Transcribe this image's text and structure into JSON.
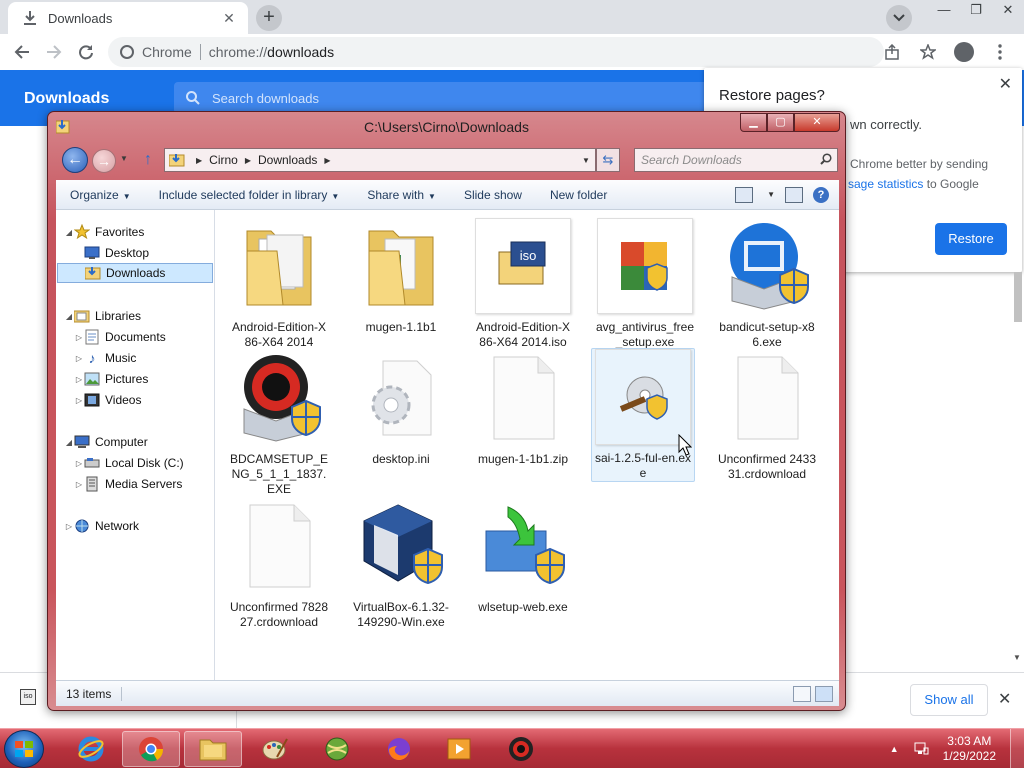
{
  "chrome": {
    "tab_title": "Downloads",
    "tab_close": "✕",
    "new_tab": "+",
    "window_min": "—",
    "window_max": "❐",
    "window_close": "✕",
    "site_name": "Chrome",
    "url_scheme": "chrome://",
    "url_host": "downloads",
    "page_title": "Downloads",
    "search_placeholder": "Search downloads",
    "icons": [
      "download-icon",
      "back-arrow-icon",
      "forward-arrow-icon",
      "reload-icon",
      "share-icon",
      "star-icon",
      "profile-icon",
      "kebab-menu-icon"
    ]
  },
  "restore_dialog": {
    "title": "Restore pages?",
    "line1": "wn correctly.",
    "line2": "Chrome better by sending",
    "line3_link": "sage statistics",
    "line3_rest": " to Google",
    "button": "Restore",
    "close": "✕"
  },
  "download_shelf": {
    "show_all": "Show all",
    "close": "✕",
    "item_icon": "iso"
  },
  "explorer": {
    "title": "C:\\Users\\Cirno\\Downloads",
    "breadcrumb": [
      "Cirno",
      "Downloads"
    ],
    "search_placeholder": "Search Downloads",
    "commands": [
      {
        "label": "Organize",
        "dropdown": true
      },
      {
        "label": "Include selected folder in library",
        "dropdown": true
      },
      {
        "label": "Share with",
        "dropdown": true
      },
      {
        "label": "Slide show",
        "dropdown": false
      },
      {
        "label": "New folder",
        "dropdown": false
      }
    ],
    "help": "?",
    "nav": {
      "favorites": "Favorites",
      "desktop": "Desktop",
      "downloads": "Downloads",
      "libraries": "Libraries",
      "documents": "Documents",
      "music": "Music",
      "pictures": "Pictures",
      "videos": "Videos",
      "computer": "Computer",
      "local_disk": "Local Disk (C:)",
      "media_servers": "Media Servers",
      "network": "Network"
    },
    "files": [
      {
        "name": "Android-Edition-X86-X64 2014",
        "icon": "folder-icon"
      },
      {
        "name": "mugen-1.1b1",
        "icon": "folder-icon"
      },
      {
        "name": "Android-Edition-X86-X64 2014.iso",
        "icon": "iso-file-icon"
      },
      {
        "name": "avg_antivirus_free_setup.exe",
        "icon": "avg-installer-icon"
      },
      {
        "name": "bandicut-setup-x86.exe",
        "icon": "bandicut-installer-icon"
      },
      {
        "name": "BDCAMSETUP_ENG_5_1_1_1837.EXE",
        "icon": "bandicam-installer-icon"
      },
      {
        "name": "desktop.ini",
        "icon": "settings-file-icon"
      },
      {
        "name": "mugen-1-1b1.zip",
        "icon": "blank-file-icon"
      },
      {
        "name": "sai-1.2.5-ful-en.exe",
        "icon": "sai-installer-icon"
      },
      {
        "name": "Unconfirmed 243331.crdownload",
        "icon": "blank-file-icon"
      },
      {
        "name": "Unconfirmed 782827.crdownload",
        "icon": "blank-file-icon"
      },
      {
        "name": "VirtualBox-6.1.32-149290-Win.exe",
        "icon": "virtualbox-installer-icon"
      },
      {
        "name": "wlsetup-web.exe",
        "icon": "windows-live-installer-icon"
      }
    ],
    "status_count": "13 items"
  },
  "taskbar": {
    "time": "3:03 AM",
    "date": "1/29/2022",
    "apps": [
      "internet-explorer-icon",
      "chrome-icon",
      "file-explorer-icon",
      "paint-icon",
      "game-icon",
      "firefox-icon",
      "media-player-icon",
      "bandicam-icon"
    ]
  },
  "colors": {
    "chrome_blue": "#1a73e8",
    "explorer_frame": "#c6545d",
    "taskbar": "#b8323d"
  }
}
